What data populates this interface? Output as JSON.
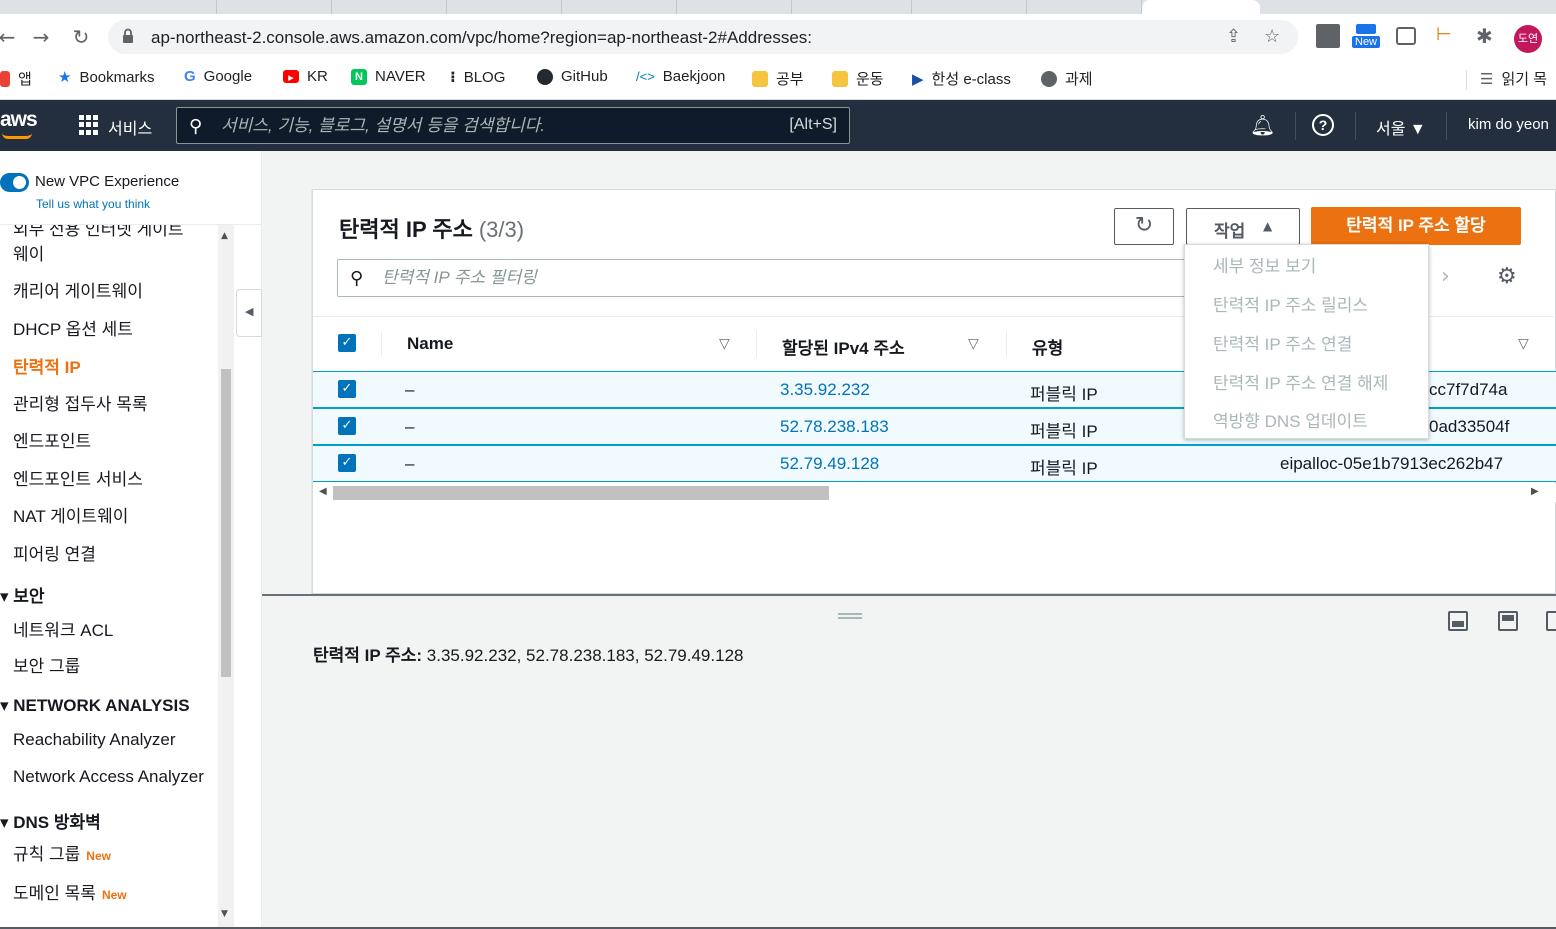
{
  "browser": {
    "url": "ap-northeast-2.console.aws.amazon.com/vpc/home?region=ap-northeast-2#Addresses:",
    "new_badge": "New",
    "profile": "도연"
  },
  "bookmarks": [
    {
      "label": "앱",
      "color": "#ea4335"
    },
    {
      "label": "Bookmarks",
      "color": "#1a73e8"
    },
    {
      "label": "Google",
      "color": "#4285f4"
    },
    {
      "label": "KR",
      "color": "#ff0000"
    },
    {
      "label": "NAVER",
      "color": "#03c75a"
    },
    {
      "label": "BLOG",
      "color": "#222222"
    },
    {
      "label": "GitHub",
      "color": "#24292f"
    },
    {
      "label": "Baekjoon",
      "color": "#0076c0"
    },
    {
      "label": "공부",
      "color": "#f5c542"
    },
    {
      "label": "운동",
      "color": "#f5c542"
    },
    {
      "label": "한성 e-class",
      "color": "#1a4fa3"
    },
    {
      "label": "과제",
      "color": "#5f6368"
    },
    {
      "label": "읽기 목",
      "color": "#5f6368"
    }
  ],
  "aws_header": {
    "logo": "aws",
    "services": "서비스",
    "search_placeholder": "서비스, 기능, 블로그, 설명서 등을 검색합니다.",
    "search_shortcut": "[Alt+S]",
    "region": "서울 ▼",
    "user": "kim do yeon"
  },
  "sidebar": {
    "vpc_experience": "New VPC Experience",
    "feedback": "Tell us what you think",
    "items": [
      {
        "label": "외부 전용 인터넷 게이트",
        "cls": ""
      },
      {
        "label": "웨이",
        "cls": ""
      },
      {
        "label": "캐리어 게이트웨이",
        "cls": ""
      },
      {
        "label": "DHCP 옵션 세트",
        "cls": ""
      },
      {
        "label": "탄력적 IP",
        "cls": "active"
      },
      {
        "label": "관리형 접두사 목록",
        "cls": ""
      },
      {
        "label": "엔드포인트",
        "cls": ""
      },
      {
        "label": "엔드포인트 서비스",
        "cls": ""
      },
      {
        "label": "NAT 게이트웨이",
        "cls": ""
      },
      {
        "label": "피어링 연결",
        "cls": ""
      }
    ],
    "section_security": "▾ 보안",
    "security_items": [
      "네트워크 ACL",
      "보안 그룹"
    ],
    "section_network": "▾ NETWORK ANALYSIS",
    "network_items": [
      "Reachability Analyzer",
      "Network Access Analyzer"
    ],
    "section_dns": "▾ DNS 방화벽",
    "dns_items": [
      {
        "label": "규칙 그룹",
        "badge": "New"
      },
      {
        "label": "도메인 목록",
        "badge": "New"
      }
    ]
  },
  "panel": {
    "title": "탄력적 IP 주소",
    "count": "(3/3)",
    "actions_label": "작업",
    "primary_label": "탄력적 IP 주소 할당",
    "filter_placeholder": "탄력적 IP 주소 필터링"
  },
  "table": {
    "columns": [
      "Name",
      "할당된 IPv4 주소",
      "유형"
    ],
    "rows": [
      {
        "name": "–",
        "ip": "3.35.92.232",
        "type": "퍼블릭 IP",
        "alloc": "cc7f7d74a"
      },
      {
        "name": "–",
        "ip": "52.78.238.183",
        "type": "퍼블릭 IP",
        "alloc": "0ad33504f"
      },
      {
        "name": "–",
        "ip": "52.79.49.128",
        "type": "퍼블릭 IP",
        "alloc": "eipalloc-05e1b7913ec262b47"
      }
    ]
  },
  "actions_menu": [
    "세부 정보 보기",
    "탄력적 IP 주소 릴리스",
    "탄력적 IP 주소 연결",
    "탄력적 IP 주소 연결 해제",
    "역방향 DNS 업데이트"
  ],
  "detail": {
    "label": "탄력적 IP 주소:",
    "value": "3.35.92.232, 52.78.238.183, 52.79.49.128"
  },
  "colors": {
    "aws_nav": "#232f3e",
    "primary": "#ec7211",
    "link": "#0073bb",
    "selected_row": "#f1faff"
  }
}
